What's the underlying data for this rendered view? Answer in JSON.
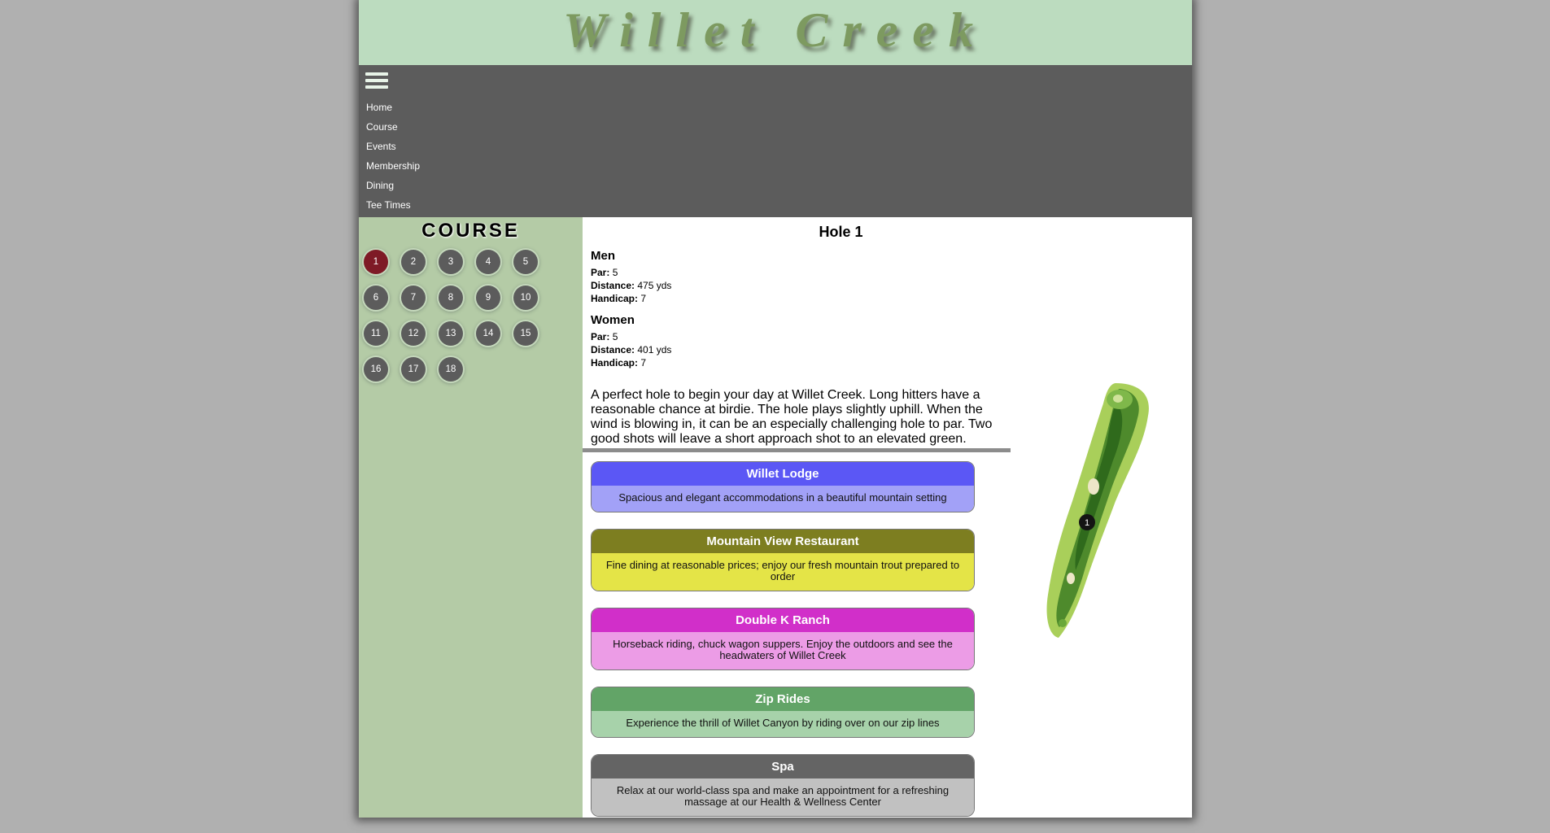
{
  "header": {
    "site_title": "Willet Creek"
  },
  "nav": {
    "menu_icon": "hamburger-menu-icon",
    "items": [
      "Home",
      "Course",
      "Events",
      "Membership",
      "Dining",
      "Tee Times"
    ]
  },
  "sidebar": {
    "title": "COURSE",
    "holes": [
      "1",
      "2",
      "3",
      "4",
      "5",
      "6",
      "7",
      "8",
      "9",
      "10",
      "11",
      "12",
      "13",
      "14",
      "15",
      "16",
      "17",
      "18"
    ],
    "active_hole": "1"
  },
  "hole": {
    "heading": "Hole 1",
    "men": {
      "title": "Men",
      "par_label": "Par:",
      "par": "5",
      "distance_label": "Distance:",
      "distance": "475 yds",
      "handicap_label": "Handicap:",
      "handicap": "7"
    },
    "women": {
      "title": "Women",
      "par_label": "Par:",
      "par": "5",
      "distance_label": "Distance:",
      "distance": "401 yds",
      "handicap_label": "Handicap:",
      "handicap": "7"
    },
    "description": "A perfect hole to begin your day at Willet Creek. Long hitters have a reasonable chance at birdie. The hole plays slightly uphill. When the wind is blowing in, it can be an especially challenging hole to par. Two good shots will leave a short approach shot to an elevated green.",
    "image_marker": "1"
  },
  "cards": [
    {
      "title": "Willet Lodge",
      "body": "Spacious and elegant accommodations in a beautiful mountain setting"
    },
    {
      "title": "Mountain View Restaurant",
      "body": "Fine dining at reasonable prices; enjoy our fresh mountain trout prepared to order"
    },
    {
      "title": "Double K Ranch",
      "body": "Horseback riding, chuck wagon suppers. Enjoy the outdoors and see the headwaters of Willet Creek"
    },
    {
      "title": "Zip Rides",
      "body": "Experience the thrill of Willet Canyon by riding over on our zip lines"
    },
    {
      "title": "Spa",
      "body": "Relax at our world-class spa and make an appointment for a refreshing massage at our Health & Wellness Center"
    }
  ]
}
